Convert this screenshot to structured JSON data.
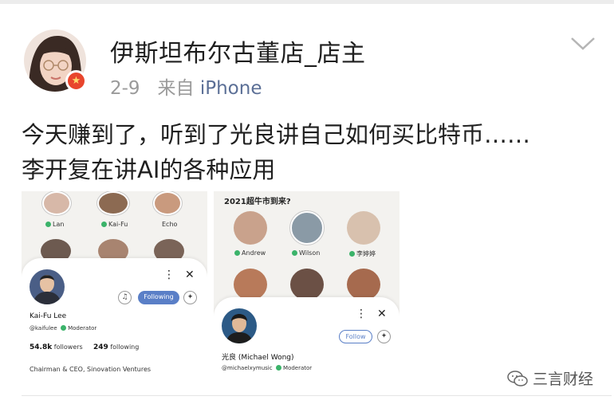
{
  "post": {
    "author": "伊斯坦布尔古董店_店主",
    "date": "2-9",
    "via": "来自",
    "device": "iPhone",
    "text_line1": "今天赚到了，听到了光良讲自己如何买比特币……",
    "text_line2": "李开复在讲AI的各种应用"
  },
  "icons": {
    "avatar": "avatar",
    "verified": "verified-badge-icon",
    "menu": "chevron-down-icon"
  },
  "image1": {
    "grid_names": [
      "Lan",
      "Kai-Fu",
      "Echo"
    ],
    "profile": {
      "name": "Kai-Fu Lee",
      "handle": "@kaifulee",
      "role": "Moderator",
      "followers": "54.8k",
      "followers_label": "followers",
      "following": "249",
      "following_label": "following",
      "bio": "Chairman & CEO, Sinovation Ventures",
      "button": "Following"
    }
  },
  "image2": {
    "room_title": "2021超牛市到来?",
    "grid_names": [
      "Andrew",
      "Wilson",
      "李婷婷"
    ],
    "profile": {
      "name": "光良 (Michael Wong)",
      "handle": "@michaelxymusic",
      "role": "Moderator",
      "button": "Follow"
    }
  },
  "watermark": "三言财经",
  "colors": {
    "verified_red": "#e8452c",
    "device_blue": "#5b6f96",
    "accent_blue": "#5a7fc7",
    "moderator_green": "#3bb36a"
  }
}
